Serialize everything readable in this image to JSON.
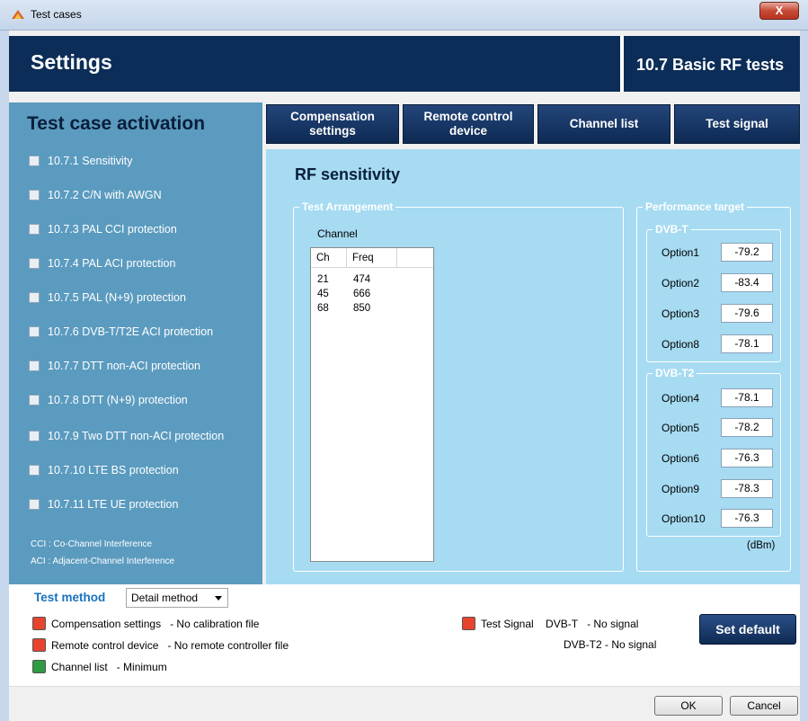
{
  "window": {
    "title": "Test cases",
    "close_label": "X"
  },
  "header": {
    "title": "Settings",
    "section": "10.7 Basic RF tests"
  },
  "left_pane": {
    "title": "Test case activation",
    "items": [
      "10.7.1 Sensitivity",
      "10.7.2 C/N with AWGN",
      "10.7.3 PAL CCI protection",
      "10.7.4 PAL ACI protection",
      "10.7.5 PAL (N+9) protection",
      "10.7.6 DVB-T/T2E ACI protection",
      "10.7.7 DTT non-ACI protection",
      "10.7.8 DTT (N+9) protection",
      "10.7.9 Two DTT non-ACI protection",
      "10.7.10 LTE BS protection",
      "10.7.11 LTE UE protection"
    ],
    "notes": [
      "CCI : Co-Channel Interference",
      "ACI : Adjacent-Channel Interference"
    ]
  },
  "tabs": {
    "compensation": "Compensation settings",
    "remote": "Remote control device",
    "channel_list": "Channel list",
    "test_signal": "Test signal"
  },
  "content": {
    "title": "RF sensitivity",
    "test_arrangement": {
      "legend": "Test Arrangement",
      "channel_label": "Channel",
      "columns": [
        "Ch",
        "Freq"
      ],
      "rows": [
        {
          "ch": "21",
          "freq": "474"
        },
        {
          "ch": "45",
          "freq": "666"
        },
        {
          "ch": "68",
          "freq": "850"
        }
      ]
    },
    "performance": {
      "legend": "Performance target",
      "dvbt": {
        "legend": "DVB-T",
        "options": [
          {
            "label": "Option1",
            "value": "-79.2"
          },
          {
            "label": "Option2",
            "value": "-83.4"
          },
          {
            "label": "Option3",
            "value": "-79.6"
          },
          {
            "label": "Option8",
            "value": "-78.1"
          }
        ]
      },
      "dvbt2": {
        "legend": "DVB-T2",
        "options": [
          {
            "label": "Option4",
            "value": "-78.1"
          },
          {
            "label": "Option5",
            "value": "-78.2"
          },
          {
            "label": "Option6",
            "value": "-76.3"
          },
          {
            "label": "Option9",
            "value": "-78.3"
          },
          {
            "label": "Option10",
            "value": "-76.3"
          }
        ]
      },
      "unit": "(dBm)"
    }
  },
  "test_method": {
    "label": "Test method",
    "selected": "Detail method"
  },
  "status": {
    "compensation": {
      "name": "Compensation settings",
      "value": "- No calibration file",
      "color": "#e8432c"
    },
    "remote": {
      "name": "Remote control device",
      "value": "- No remote controller file",
      "color": "#e8432c"
    },
    "channel_list": {
      "name": "Channel list",
      "value": "- Minimum",
      "color": "#2f9b43"
    },
    "test_signal": {
      "name": "Test Signal",
      "color": "#e8432c",
      "dvbt_label": "DVB-T",
      "dvbt_value": "- No signal",
      "dvbt2_label": "DVB-T2",
      "dvbt2_value": "- No signal"
    }
  },
  "buttons": {
    "set_default": "Set default",
    "ok": "OK",
    "cancel": "Cancel"
  }
}
